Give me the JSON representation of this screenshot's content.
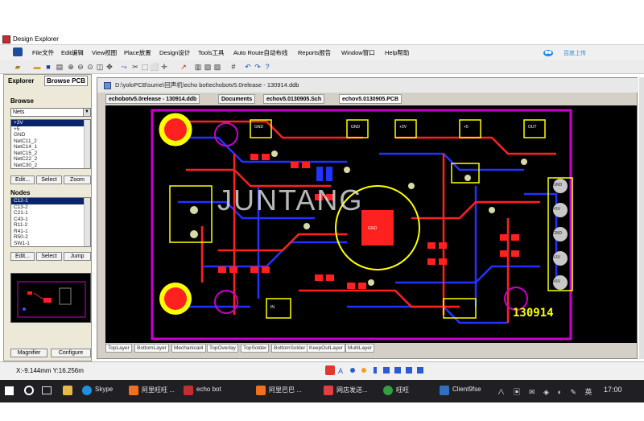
{
  "window": {
    "title": "Design Explorer"
  },
  "menu": [
    "File文件",
    "Edit编辑",
    "View视图",
    "Place放置",
    "Design设计",
    "Tools工具",
    "Auto Route自动布线",
    "Reports报告",
    "Window窗口",
    "Help帮助"
  ],
  "cloud_button": "百度上传",
  "panel": {
    "tabs": [
      "Explorer",
      "Browse PCB"
    ],
    "browse_label": "Browse",
    "browse_value": "Nets",
    "nets": [
      "+3V",
      "+5",
      "GND",
      "NetC11_2",
      "NetC14_1",
      "NetC15_2",
      "NetC22_2",
      "NetC30_2"
    ],
    "buttons1": [
      "Edit...",
      "Select",
      "Zoom"
    ],
    "nodes_label": "Nodes",
    "nodes": [
      "C12-1",
      "C13-2",
      "C21-1",
      "C43-1",
      "R11-2",
      "R41-1",
      "R50-2",
      "SW1-1"
    ],
    "buttons2": [
      "Edit...",
      "Select",
      "Jump"
    ],
    "bottom_buttons": [
      "Magnifier",
      "Configure"
    ]
  },
  "doc": {
    "path": "D:\\yoloPCB\\sume\\回声机\\echo bot\\echobotv5.0release - 130914.ddb",
    "tabs": [
      "echobotv5.0release - 130914.ddb",
      "Documents",
      "echov5.0130905.Sch",
      "echov5.0130905.PCB"
    ]
  },
  "pcb": {
    "board_text": "130914",
    "labels": [
      "GND",
      "GND",
      "GND",
      "+3V",
      "+5",
      "OUT",
      "GND",
      "+5V",
      "GND",
      "+3V",
      "+5V",
      "IN"
    ],
    "watermark": "JUNTANG",
    "colors": {
      "board_outline": "#cc00cc",
      "top": "#ff2020",
      "bottom": "#2233ff",
      "overlay": "#ffff00"
    }
  },
  "layers": [
    "TopLayer",
    "BottomLayer",
    "Mechanical4",
    "TopOverlay",
    "TopSolder",
    "BottomSolder",
    "KeepOutLayer",
    "MultiLayer"
  ],
  "status": {
    "coords": "X:-9.144mm Y:16.256m"
  },
  "taskbar": {
    "items": [
      "Skype",
      "阿里旺旺 ...",
      "echo bot",
      "阿里巴巴 ...",
      "网店发送...",
      "旺旺",
      "Client9fse"
    ],
    "time": "17:00"
  }
}
